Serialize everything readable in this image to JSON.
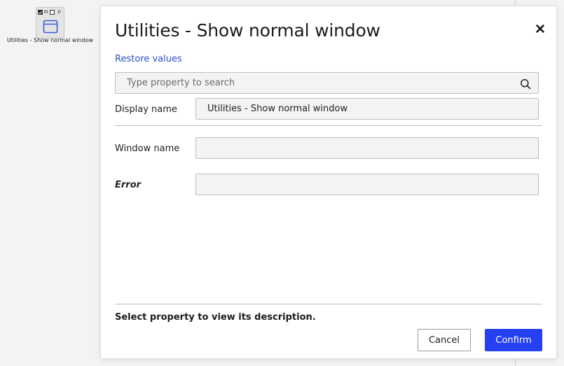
{
  "canvas": {
    "node": {
      "flags": [
        {
          "letter": "M",
          "checked": true
        },
        {
          "letter": "D",
          "checked": false
        }
      ],
      "flag_m": "M",
      "flag_d": "D",
      "label": "Utilities - Show normal window",
      "icon": "window-icon"
    }
  },
  "dialog": {
    "title": "Utilities - Show normal window",
    "close_icon": "close-icon",
    "restore_label": "Restore values",
    "search": {
      "placeholder": "Type property to search",
      "value": "",
      "icon": "search-icon"
    },
    "properties": [
      {
        "label": "Display name",
        "value": "Utilities - Show normal window"
      },
      {
        "label": "Window name",
        "value": ""
      },
      {
        "label": "Error",
        "value": ""
      }
    ],
    "description": "Select property to view its description.",
    "cancel_label": "Cancel",
    "confirm_label": "Confirm",
    "accent_color": "#2440f0",
    "link_color": "#2a4fc8"
  }
}
